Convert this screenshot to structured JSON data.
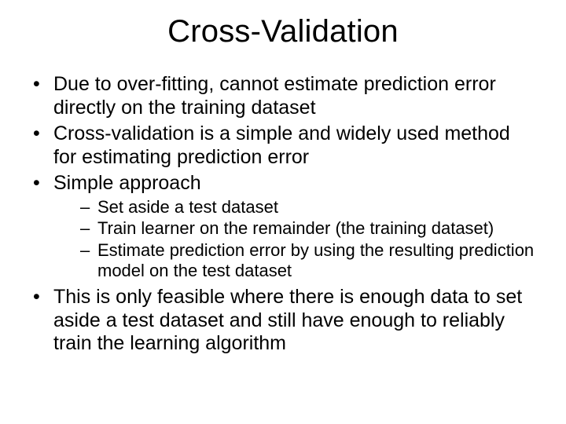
{
  "title": "Cross-Validation",
  "bullets": {
    "b1": "Due to over-fitting, cannot estimate prediction error directly on the training dataset",
    "b2": "Cross-validation is a simple and widely used method for estimating prediction error",
    "b3": "Simple approach",
    "b3_sub": {
      "s1": "Set aside a test dataset",
      "s2": "Train learner on the remainder (the training dataset)",
      "s3": "Estimate prediction error by using the resulting prediction model on the test dataset"
    },
    "b4": "This is only feasible where there is enough data to set aside a test dataset and still have enough to reliably train the learning algorithm"
  }
}
